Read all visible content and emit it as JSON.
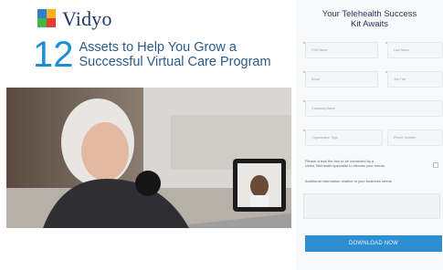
{
  "brand": {
    "name": "Vidyo",
    "logo_icon": "vidyo-logo-icon"
  },
  "headline": {
    "number": "12",
    "line1": "Assets to Help You Grow a",
    "line2": "Successful Virtual Care Program"
  },
  "hero_image": {
    "icon": "telehealth-video-call-photo"
  },
  "form": {
    "title_line1": "Your Telehealth Success",
    "title_line2": "Kit Awaits",
    "fields": {
      "first_name": "First Name",
      "last_name": "Last Name",
      "email": "Email",
      "job_title": "Job Title",
      "company": "Company Name",
      "organization_type": "Organization Type",
      "phone": "Phone Number"
    },
    "consent_line1": "Please check the box to be contacted by a",
    "consent_line2": "Video Telehealth specialist to discuss your needs",
    "additional_info": "Additional information relative to your business needs",
    "submit_label": "DOWNLOAD NOW"
  },
  "colors": {
    "accent": "#2d8fd2",
    "brand_dark": "#1e3b6e",
    "headline_blue": "#1b8fd6"
  }
}
